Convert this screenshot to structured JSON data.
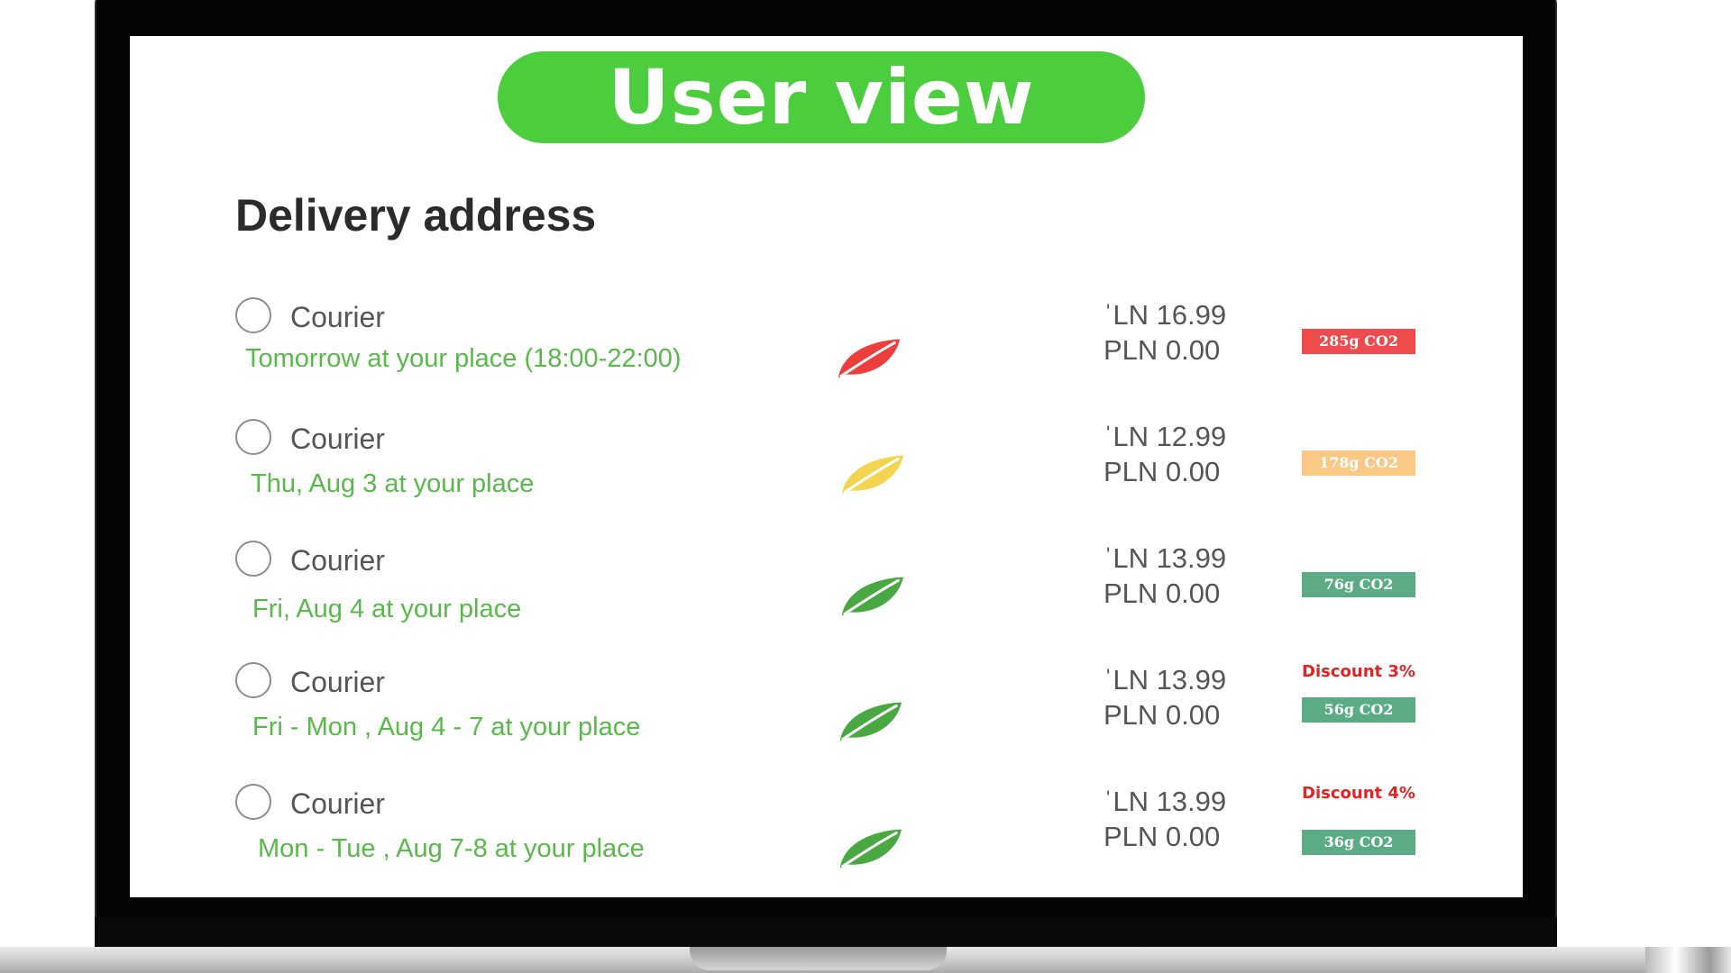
{
  "banner": {
    "title": "User view"
  },
  "section": {
    "title": "Delivery address"
  },
  "options": [
    {
      "method": "Courier",
      "when": "Tomorrow at your place (18:00-22:00)",
      "price": "ˈLN 16.99",
      "price_after": "PLN 0.00",
      "discount": "",
      "co2": "285g CO2",
      "co2_color": "#ee4c4c",
      "leaf_color": "#ee3d3d",
      "leaf_icon": "leaf-icon"
    },
    {
      "method": "Courier",
      "when": "Thu, Aug 3 at your place",
      "price": "ˈLN 12.99",
      "price_after": "PLN 0.00",
      "discount": "",
      "co2": "178g CO2",
      "co2_color": "#f9c885",
      "leaf_color": "#f3d44f",
      "leaf_icon": "leaf-icon"
    },
    {
      "method": "Courier",
      "when": "Fri, Aug 4 at your place",
      "price": "ˈLN 13.99",
      "price_after": "PLN 0.00",
      "discount": "",
      "co2": "76g CO2",
      "co2_color": "#5bab85",
      "leaf_color": "#4aa842",
      "leaf_icon": "leaf-icon"
    },
    {
      "method": "Courier",
      "when": "Fri - Mon , Aug 4 - 7 at your place",
      "price": "ˈLN 13.99",
      "price_after": "PLN 0.00",
      "discount": "Discount 3%",
      "co2": "56g CO2",
      "co2_color": "#5bab85",
      "leaf_color": "#4aa842",
      "leaf_icon": "leaf-icon"
    },
    {
      "method": "Courier",
      "when": "Mon - Tue , Aug 7-8 at your place",
      "price": "ˈLN 13.99",
      "price_after": "PLN 0.00",
      "discount": "Discount 4%",
      "co2": "36g CO2",
      "co2_color": "#5bab85",
      "leaf_color": "#4aa842",
      "leaf_icon": "leaf-icon"
    }
  ]
}
